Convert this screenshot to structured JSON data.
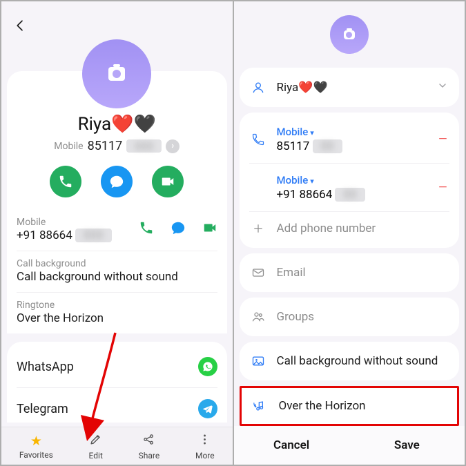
{
  "left": {
    "name": "Riya❤️🖤",
    "main_type": "Mobile",
    "main_number": "85117",
    "actions": [
      "call",
      "message",
      "video"
    ],
    "other_number_type": "Mobile",
    "other_number": "+91 88664",
    "call_bg_label": "Call background",
    "call_bg_value": "Call background without sound",
    "ringtone_label": "Ringtone",
    "ringtone_value": "Over the Horizon",
    "apps": [
      {
        "name": "WhatsApp",
        "icon": "whatsapp"
      },
      {
        "name": "Telegram",
        "icon": "telegram"
      }
    ],
    "bottom": {
      "favorites": "Favorites",
      "edit": "Edit",
      "share": "Share",
      "more": "More"
    }
  },
  "right": {
    "name": "Riya❤️🖤",
    "phones": [
      {
        "type": "Mobile",
        "number": "85117"
      },
      {
        "type": "Mobile",
        "number": "+91 88664"
      }
    ],
    "add_phone": "Add phone number",
    "email": "Email",
    "groups": "Groups",
    "call_bg": "Call background without sound",
    "ringtone": "Over the Horizon",
    "cancel": "Cancel",
    "save": "Save"
  }
}
